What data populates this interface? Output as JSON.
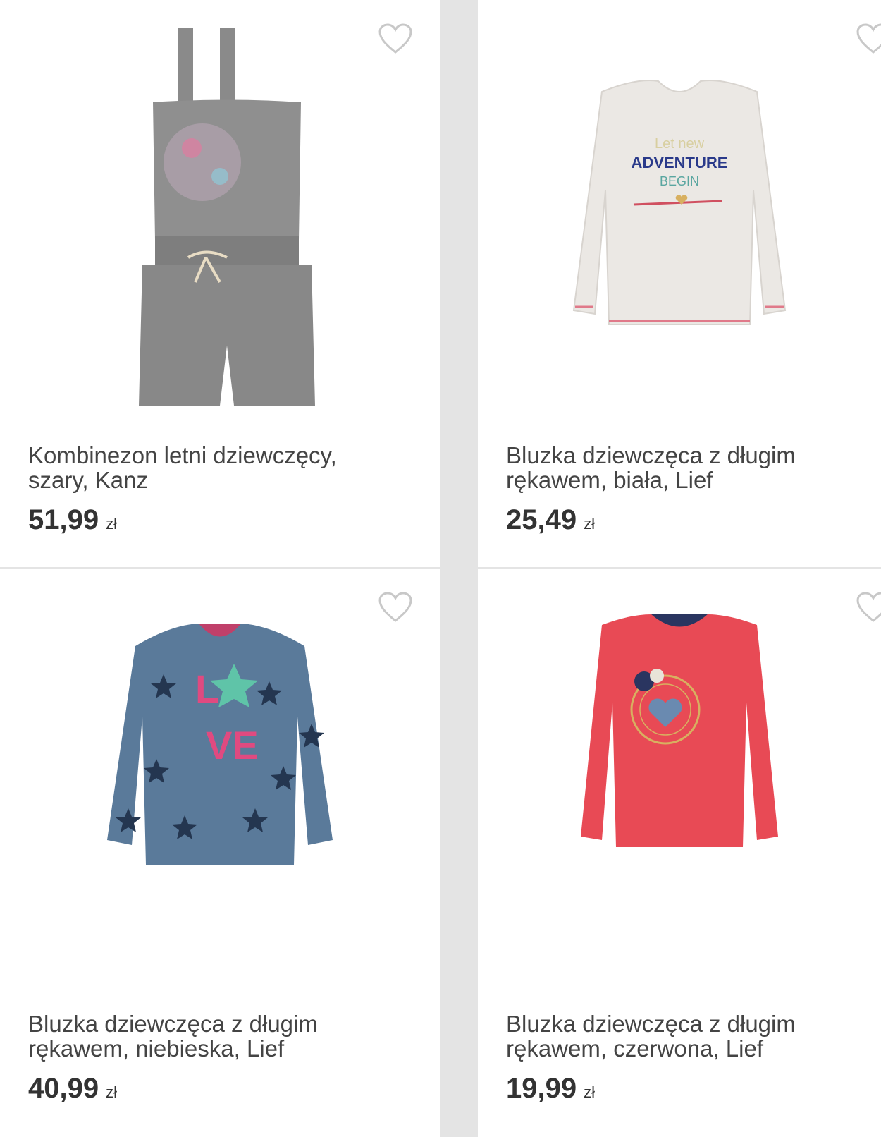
{
  "products": [
    {
      "title": "Kombinezon letni dziewczęcy, szary, Kanz",
      "price": "51,99",
      "currency": "zł",
      "image": "gray-romper-image",
      "favorite_icon": "heart-outline-icon"
    },
    {
      "title": "Bluzka dziewczęca z długim rękawem, biała, Lief",
      "price": "25,49",
      "currency": "zł",
      "image": "white-longsleeve-image",
      "favorite_icon": "heart-outline-icon",
      "print_text": [
        "Let new",
        "ADVENTURE",
        "BEGIN"
      ]
    },
    {
      "title": "Bluzka dziewczęca z długim rękawem, niebieska, Lief",
      "price": "40,99",
      "currency": "zł",
      "image": "blue-star-sweatshirt-image",
      "favorite_icon": "heart-outline-icon",
      "print_text": [
        "L",
        "VE"
      ]
    },
    {
      "title": "Bluzka dziewczęca z długim rękawem, czerwona, Lief",
      "price": "19,99",
      "currency": "zł",
      "image": "red-longsleeve-image",
      "favorite_icon": "heart-outline-icon"
    }
  ],
  "colors": {
    "background": "#e4e4e4",
    "card": "#ffffff",
    "text": "#333333"
  }
}
